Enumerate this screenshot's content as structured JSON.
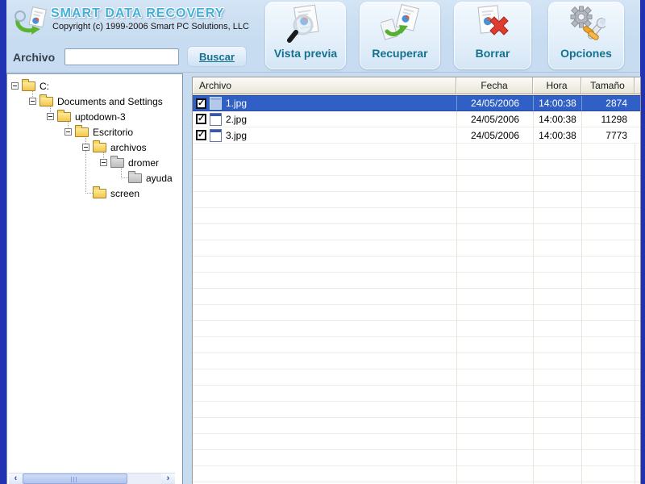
{
  "window": {
    "app_title": "SMART DATA RECOVERY",
    "copyright": "Copyright (c) 1999-2006 Smart PC Solutions, LLC"
  },
  "search": {
    "label": "Archivo",
    "value": "",
    "button_label": "Buscar"
  },
  "toolbar": {
    "buttons": [
      {
        "label": "Vista previa",
        "icon": "preview-document-icon"
      },
      {
        "label": "Recuperar",
        "icon": "recover-document-icon"
      },
      {
        "label": "Borrar",
        "icon": "delete-document-icon"
      },
      {
        "label": "Opciones",
        "icon": "options-gear-wrench-icon"
      }
    ]
  },
  "tree": {
    "items": [
      {
        "label": "C:",
        "level": 0,
        "expanded": true,
        "folder_color": "yellow"
      },
      {
        "label": "Documents and Settings",
        "level": 1,
        "expanded": true,
        "folder_color": "yellow"
      },
      {
        "label": "uptodown-3",
        "level": 2,
        "expanded": true,
        "folder_color": "yellow"
      },
      {
        "label": "Escritorio",
        "level": 3,
        "expanded": true,
        "folder_color": "yellow"
      },
      {
        "label": "archivos",
        "level": 4,
        "expanded": true,
        "folder_color": "yellow"
      },
      {
        "label": "dromer",
        "level": 5,
        "expanded": true,
        "folder_color": "gray"
      },
      {
        "label": "ayuda",
        "level": 6,
        "leaf": true,
        "folder_color": "gray"
      },
      {
        "label": "screen",
        "level": 4,
        "leaf": true,
        "folder_color": "yellow"
      }
    ]
  },
  "table": {
    "columns": {
      "file": "Archivo",
      "date": "Fecha",
      "time": "Hora",
      "size": "Tamaño"
    },
    "rows": [
      {
        "name": "1.jpg",
        "date": "24/05/2006",
        "time": "14:00:38",
        "size": "2874",
        "checked": true,
        "selected": true
      },
      {
        "name": "2.jpg",
        "date": "24/05/2006",
        "time": "14:00:38",
        "size": "11298",
        "checked": true,
        "selected": false
      },
      {
        "name": "3.jpg",
        "date": "24/05/2006",
        "time": "14:00:38",
        "size": "7773",
        "checked": true,
        "selected": false
      }
    ]
  },
  "colors": {
    "selection_blue": "#3060c6",
    "accent_teal": "#15718f",
    "title_blue": "#41b0da",
    "window_border_blue": "#2132b2"
  }
}
